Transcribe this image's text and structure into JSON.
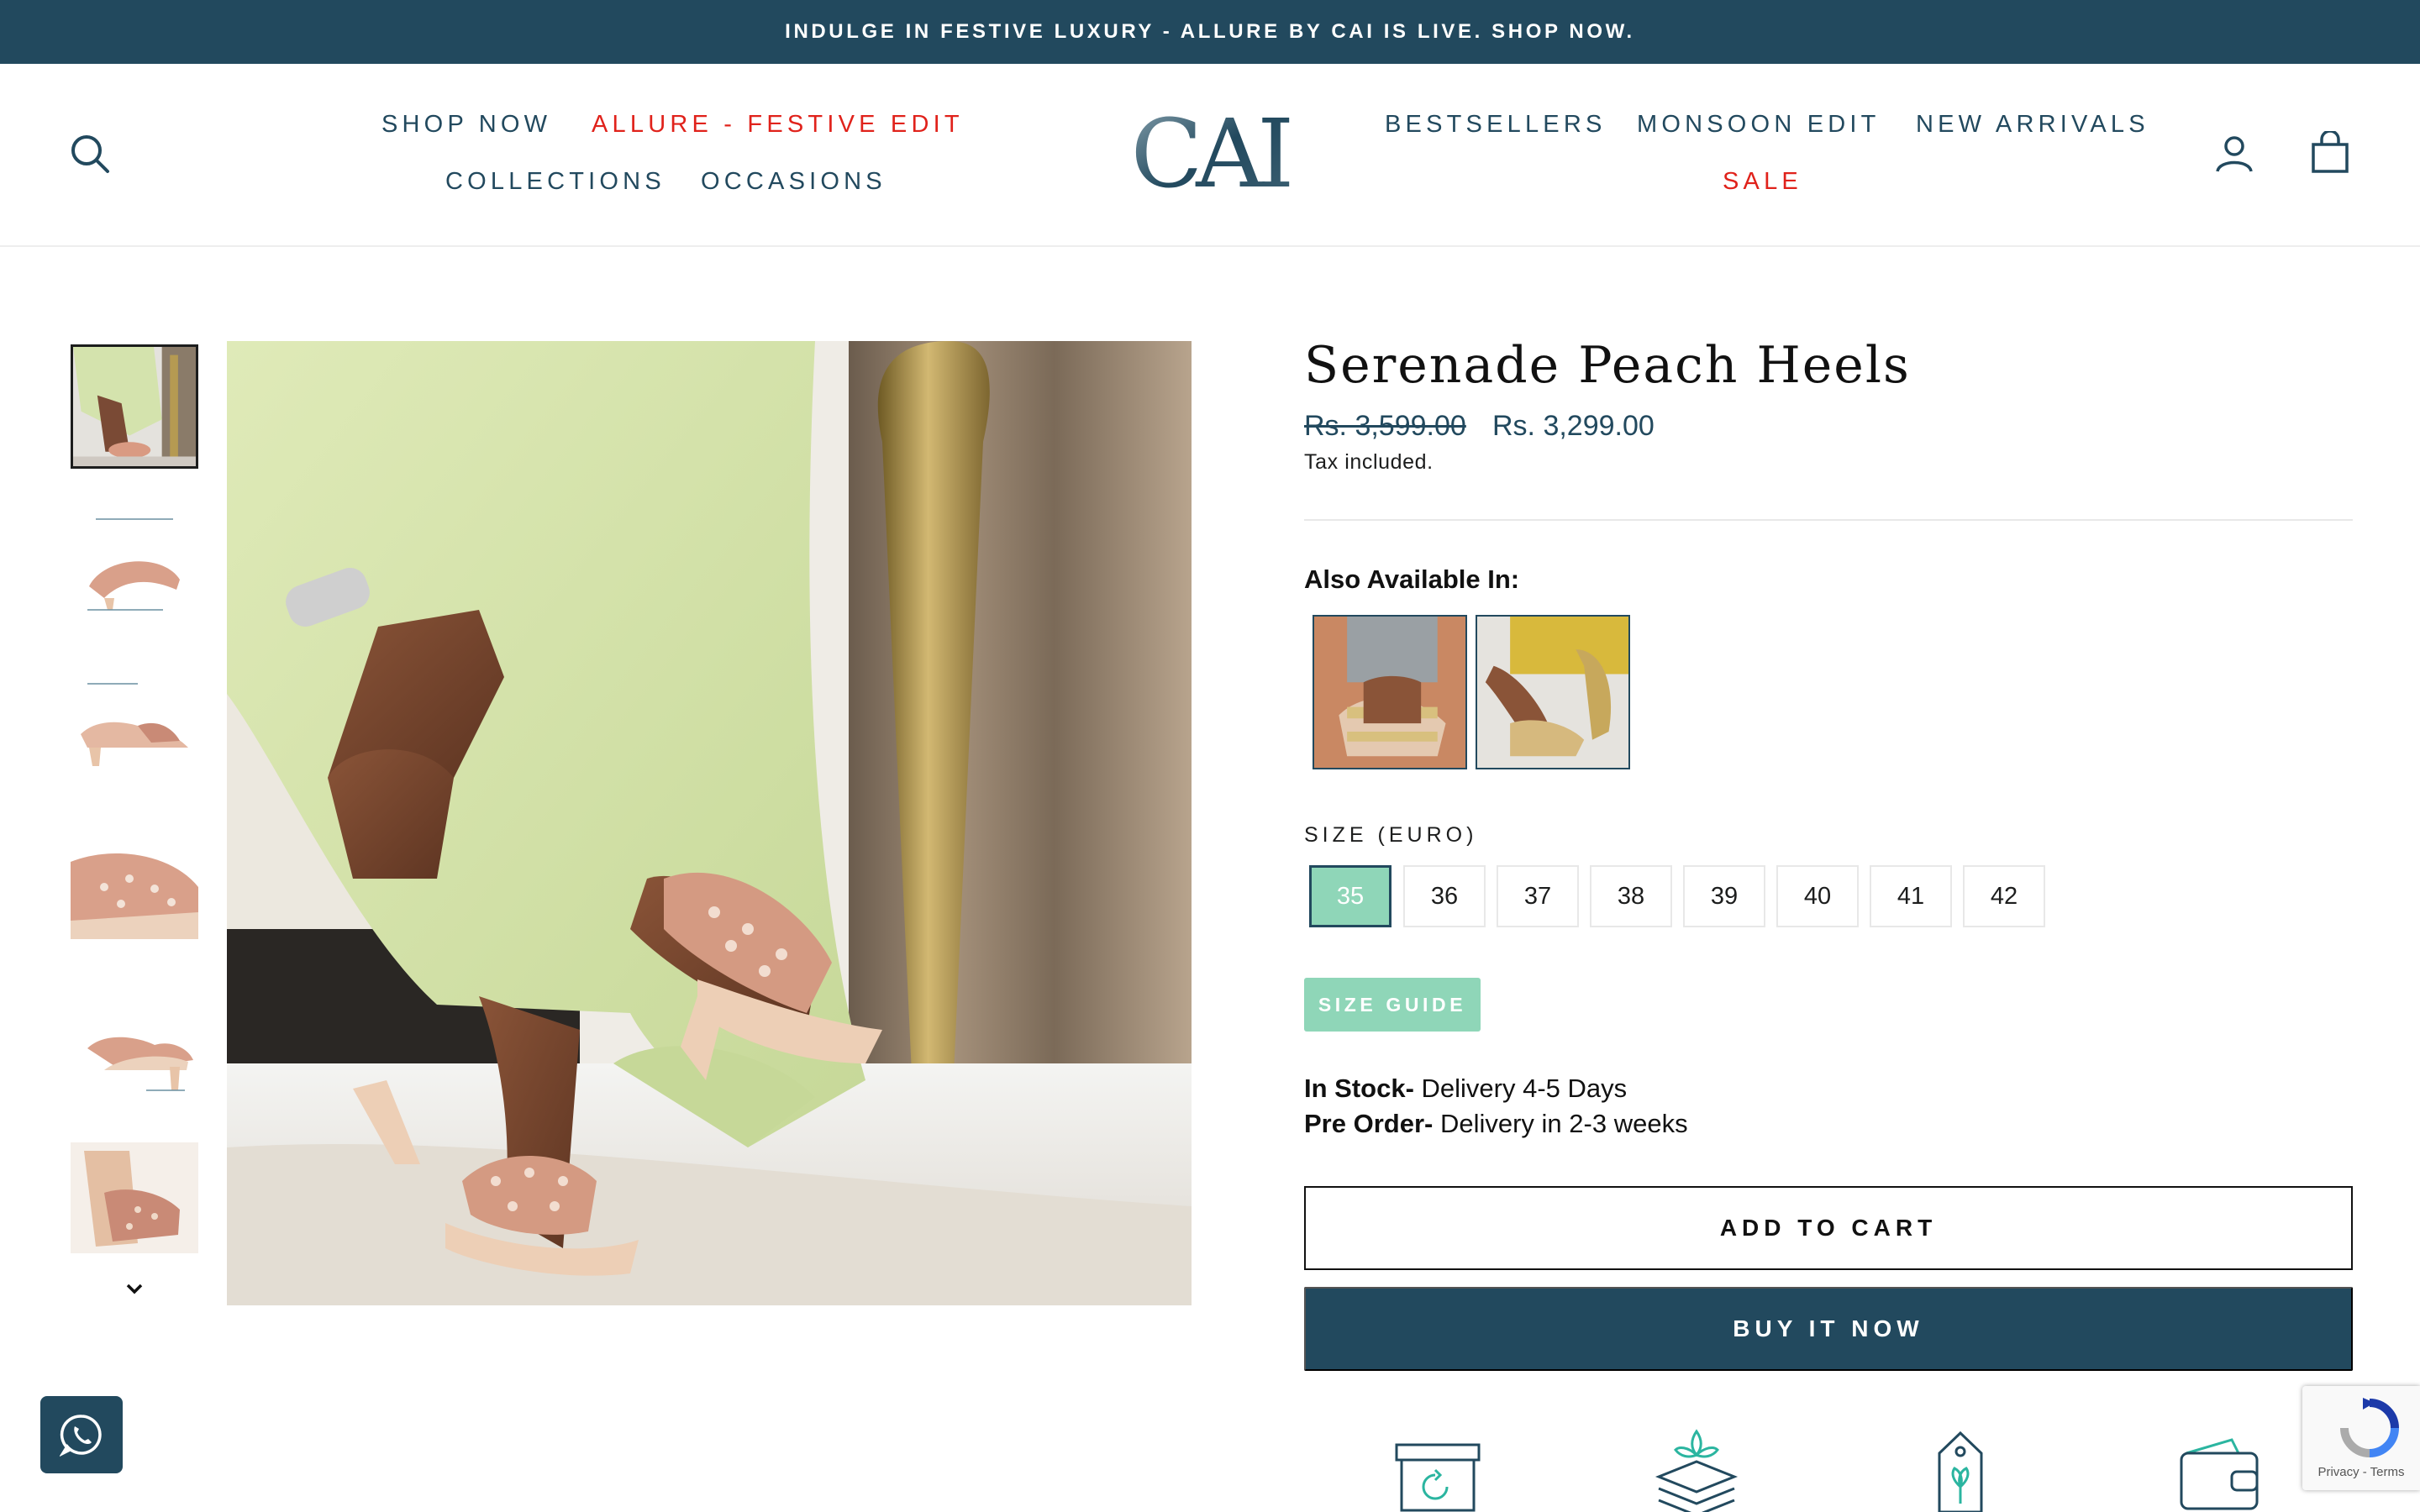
{
  "announcement": {
    "text": "INDULGE IN FESTIVE LUXURY - ALLURE BY CAI IS LIVE. SHOP NOW."
  },
  "header": {
    "logo_text": "CAI",
    "nav_left": [
      {
        "label": "SHOP NOW",
        "highlight": false
      },
      {
        "label": "ALLURE - FESTIVE EDIT",
        "highlight": true
      },
      {
        "label": "COLLECTIONS",
        "highlight": false
      },
      {
        "label": "OCCASIONS",
        "highlight": false
      }
    ],
    "nav_right": [
      {
        "label": "BESTSELLERS",
        "highlight": false
      },
      {
        "label": "MONSOON EDIT",
        "highlight": false
      },
      {
        "label": "NEW ARRIVALS",
        "highlight": false
      },
      {
        "label": "SALE",
        "highlight": true
      }
    ],
    "icons": [
      "search-icon",
      "account-icon",
      "cart-icon"
    ]
  },
  "gallery": {
    "thumbnails": [
      {
        "name": "lifestyle-shot",
        "active": true
      },
      {
        "name": "annotated-front-view",
        "active": false
      },
      {
        "name": "annotated-side-view",
        "active": false
      },
      {
        "name": "close-up-detail",
        "active": false
      },
      {
        "name": "annotated-angle-view",
        "active": false
      },
      {
        "name": "heel-back-view",
        "active": false
      }
    ],
    "scroll_icon": "chevron-down-icon"
  },
  "product": {
    "title": "Serenade Peach Heels",
    "compare_price": "Rs. 3,599.00",
    "price": "Rs. 3,299.00",
    "tax_note": "Tax included.",
    "also_available_label": "Also Available In:",
    "variants": [
      "variant-gold-strappy-sandal",
      "variant-gold-block-heel"
    ],
    "size_label": "SIZE (EURO)",
    "sizes": [
      "35",
      "36",
      "37",
      "38",
      "39",
      "40",
      "41",
      "42"
    ],
    "selected_size": "35",
    "size_guide_label": "SIZE GUIDE",
    "stock": [
      {
        "label": "In Stock-",
        "value": " Delivery 4-5 Days"
      },
      {
        "label": "Pre Order-",
        "value": " Delivery in 2-3 weeks"
      }
    ],
    "add_to_cart_label": "ADD TO CART",
    "buy_now_label": "BUY IT NOW"
  },
  "features": [
    "easy-returns-icon",
    "layered-packaging-icon",
    "eco-tag-icon",
    "wallet-icon"
  ],
  "whatsapp_icon": "whatsapp-icon",
  "recaptcha": {
    "text": "Privacy - Terms"
  },
  "colors": {
    "brand": "#22495e",
    "accent_red": "#e0221b",
    "mint": "#8fd6b8"
  }
}
